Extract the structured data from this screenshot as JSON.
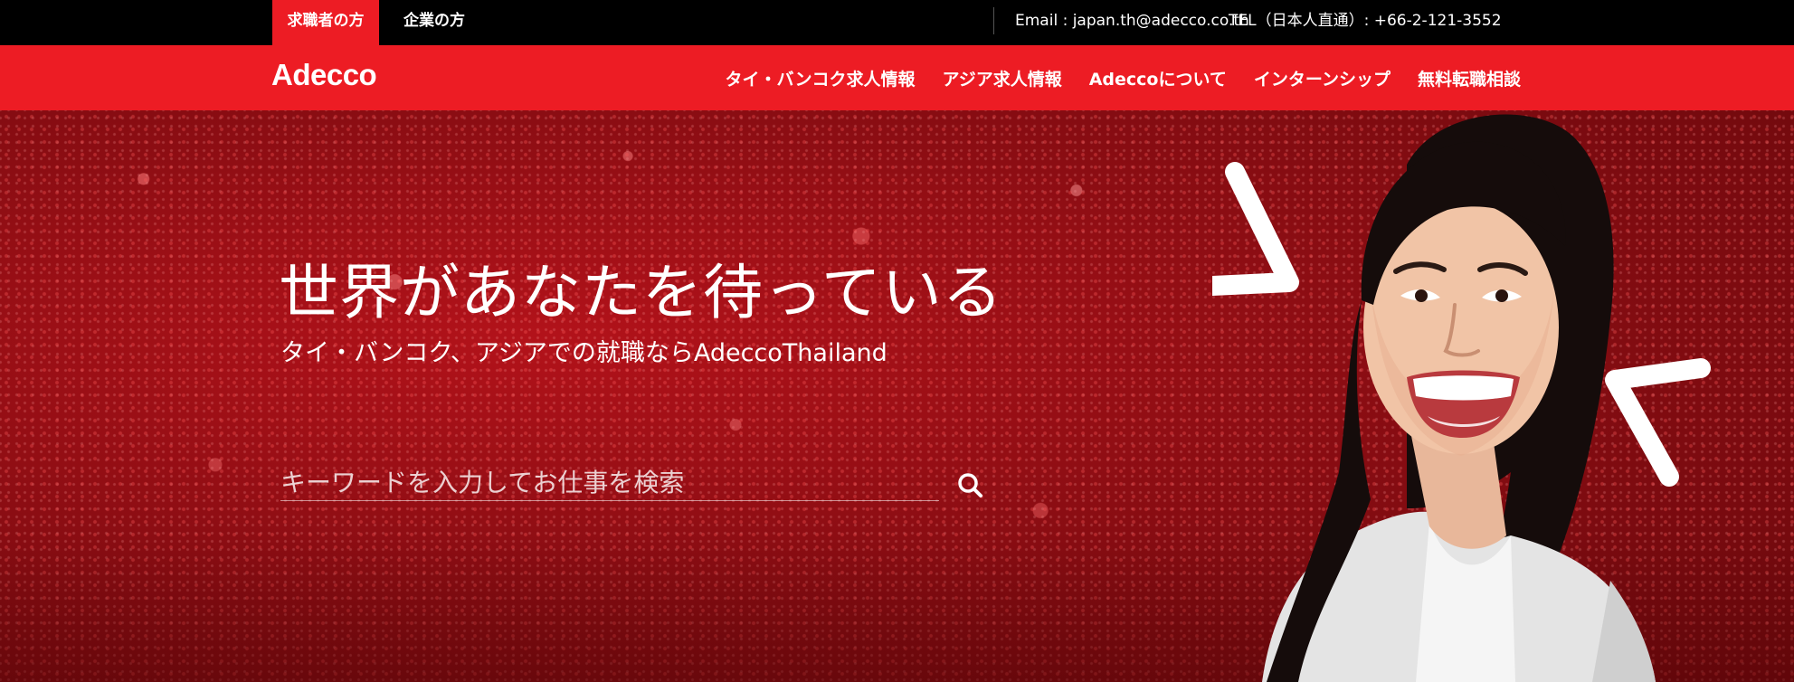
{
  "topbar": {
    "tabs": [
      {
        "label": "求職者の方",
        "active": true
      },
      {
        "label": "企業の方",
        "active": false
      }
    ],
    "email": "Email : japan.th@adecco.co.th",
    "tel": "TEL（日本人直通）: +66-2-121-3552"
  },
  "navbar": {
    "logo": "Adecco",
    "items": [
      "タイ・バンコク求人情報",
      "アジア求人情報",
      "Adeccoについて",
      "インターンシップ",
      "無料転職相談"
    ]
  },
  "hero": {
    "headline": "世界があなたを待っている",
    "subheadline": "タイ・バンコク、アジアでの就職ならAdeccoThailand",
    "search": {
      "placeholder": "キーワードを入力してお仕事を検索",
      "value": ""
    }
  },
  "colors": {
    "brand_red": "#ed1c24",
    "topbar_black": "#000000"
  },
  "icons": {
    "search": "search-icon",
    "hero_image": "smiling-woman-photo"
  }
}
